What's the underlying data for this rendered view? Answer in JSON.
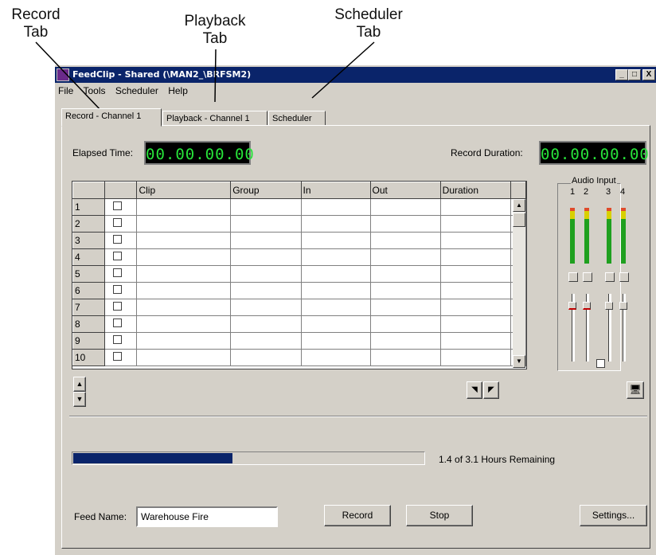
{
  "callouts": {
    "record": [
      "Record",
      "Tab"
    ],
    "playback": [
      "Playback",
      "Tab"
    ],
    "scheduler": [
      "Scheduler",
      "Tab"
    ]
  },
  "window": {
    "title": "FeedClip -  Shared (\\MAN2_\\BRFSM2)",
    "controls": [
      "_",
      "□",
      "X"
    ]
  },
  "menu": [
    "File",
    "Tools",
    "Scheduler",
    "Help"
  ],
  "tabs": [
    "Record - Channel 1",
    "Playback - Channel 1",
    "Scheduler"
  ],
  "elapsed": {
    "label": "Elapsed Time:",
    "value": "00.00.00.00"
  },
  "record_duration": {
    "label": "Record Duration:",
    "value": "00.00.00.00"
  },
  "grid": {
    "columns": [
      "Clip",
      "Group",
      "In",
      "Out",
      "Duration"
    ],
    "rows": [
      "1",
      "2",
      "3",
      "4",
      "5",
      "6",
      "7",
      "8",
      "9",
      "10"
    ]
  },
  "audio": {
    "title": "Audio Input",
    "channels": [
      "1",
      "2",
      "3",
      "4"
    ]
  },
  "progress": {
    "value": 0.452,
    "text": "1.4 of 3.1 Hours Remaining"
  },
  "feed": {
    "label": "Feed Name:",
    "value": "Warehouse Fire"
  },
  "buttons": {
    "record": "Record",
    "stop": "Stop",
    "settings": "Settings..."
  },
  "colors": {
    "titlebar": "#0a246a",
    "lcd_text": "#27e43a",
    "progress": "#0a246a",
    "window": "#d4d0c8"
  }
}
